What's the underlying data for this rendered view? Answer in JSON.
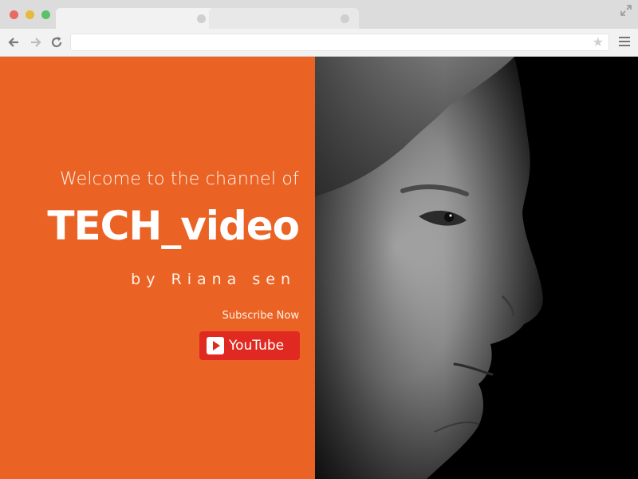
{
  "browser": {
    "tabs": [
      {
        "label": "",
        "active": true
      },
      {
        "label": "",
        "active": false
      }
    ],
    "address_bar": {
      "value": "",
      "placeholder": ""
    },
    "icons": {
      "back": "arrow-left-icon",
      "forward": "arrow-right-icon",
      "reload": "reload-icon",
      "bookmark": "star-icon",
      "menu": "hamburger-menu-icon",
      "fullscreen": "expand-icon"
    }
  },
  "hero": {
    "welcome_text": "Welcome to the channel of",
    "channel_name": "TECH_video",
    "byline": "by Riana sen",
    "subscribe_prompt": "Subscribe Now",
    "youtube_button_label": "YouTube",
    "accent_color": "#ea6325",
    "button_color": "#e02a21",
    "image": "monochrome-portrait-woman-profile"
  }
}
